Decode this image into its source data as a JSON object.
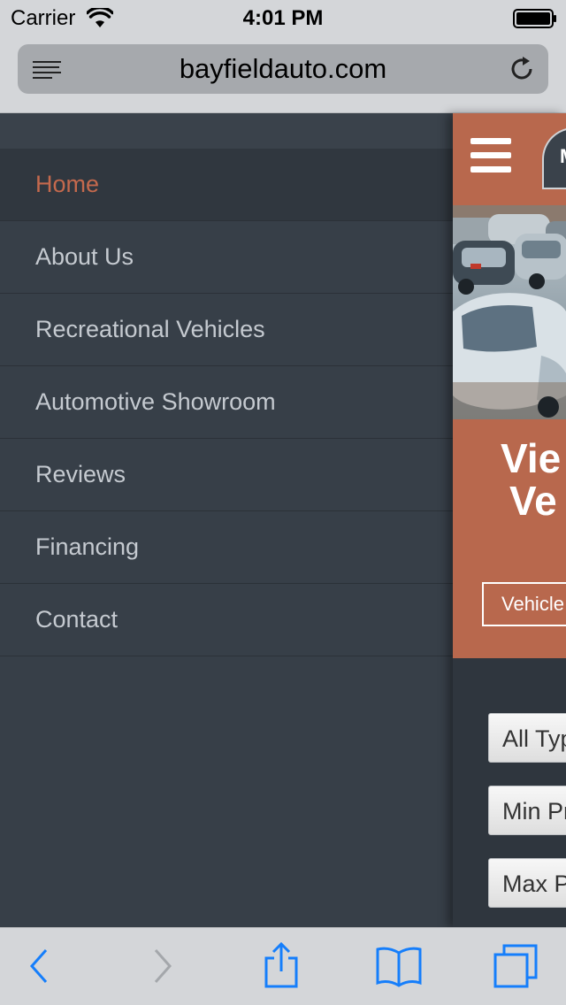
{
  "status_bar": {
    "carrier": "Carrier",
    "time": "4:01 PM"
  },
  "browser": {
    "url": "bayfieldauto.com"
  },
  "menu": {
    "items": [
      {
        "label": "Home",
        "active": true
      },
      {
        "label": "About Us"
      },
      {
        "label": "Recreational Vehicles"
      },
      {
        "label": "Automotive Showroom"
      },
      {
        "label": "Reviews"
      },
      {
        "label": "Financing"
      },
      {
        "label": "Contact"
      }
    ]
  },
  "page": {
    "logo_text": "M",
    "promo": {
      "title_line1": "Vie",
      "title_line2": "Ve",
      "button": "Vehicle"
    },
    "filters": {
      "type": "All Typ",
      "min_price": "Min Pr",
      "max_price": "Max P"
    }
  },
  "colors": {
    "accent": "#b8684d",
    "menu_bg": "#373f48",
    "active_text": "#c4694d",
    "ios_blue": "#157efb"
  },
  "icons": [
    "wifi-icon",
    "battery-icon",
    "reader-icon",
    "reload-icon",
    "hamburger-icon",
    "back-icon",
    "forward-icon",
    "share-icon",
    "bookmarks-icon",
    "tabs-icon"
  ]
}
